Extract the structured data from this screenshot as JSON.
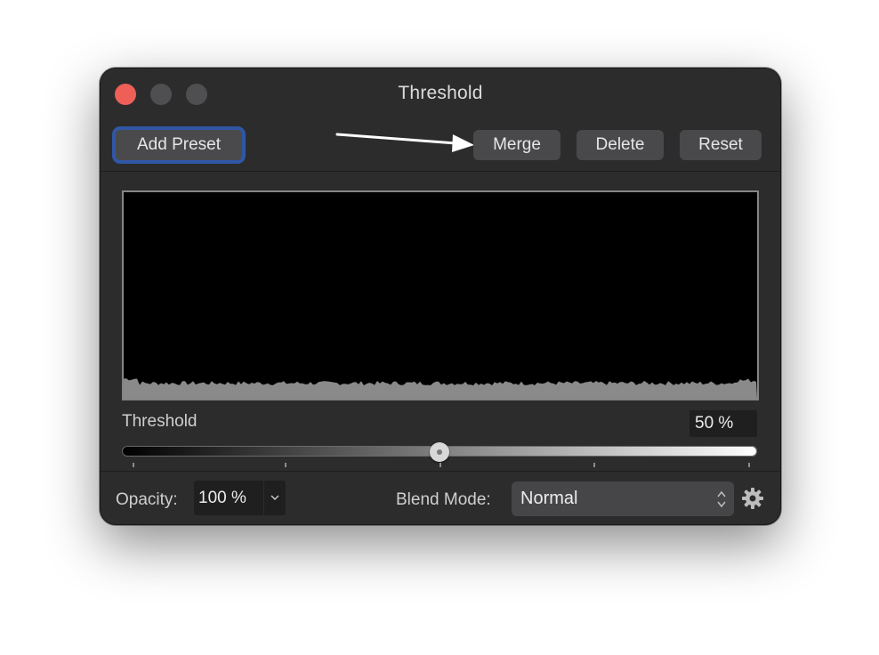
{
  "window": {
    "title": "Threshold"
  },
  "toolbar": {
    "add_preset_label": "Add Preset",
    "merge_label": "Merge",
    "delete_label": "Delete",
    "reset_label": "Reset"
  },
  "threshold": {
    "label": "Threshold",
    "value_text": "50 %",
    "level_percent": 50
  },
  "footer": {
    "opacity_label": "Opacity:",
    "opacity_value": "100 %",
    "blend_label": "Blend Mode:",
    "blend_value": "Normal"
  },
  "colors": {
    "window_bg": "#2c2c2d",
    "close_button": "#ee5f57",
    "focus_ring": "#2f57a5",
    "button_bg": "#49494b"
  },
  "icons": {
    "close": "close-icon",
    "minimize": "minimize-icon",
    "maximize": "maximize-icon",
    "arrow": "arrow-annotation-icon",
    "dropdown": "chevron-down-icon",
    "updown": "updown-chevron-icon",
    "settings": "gear-icon"
  }
}
